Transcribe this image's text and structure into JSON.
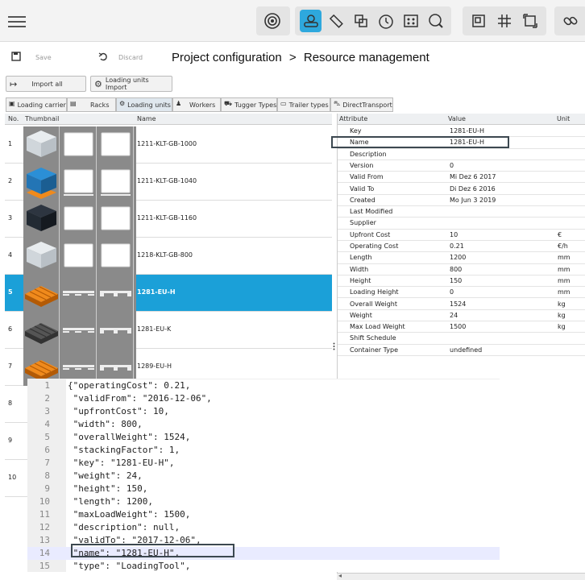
{
  "toolbar": {
    "menu_icon": "hamburger-icon",
    "tools": [
      "lens-icon",
      "resource-icon",
      "ruler-icon",
      "cut-icon",
      "timer-icon",
      "grid-icon",
      "search-zoom-icon",
      "frame-icon",
      "grid-lines-icon",
      "resize-icon",
      "link-icon"
    ],
    "accent": "#2ea8dd"
  },
  "actions": {
    "save": "Save",
    "discard": "Discard"
  },
  "breadcrumb": {
    "project": "Project configuration",
    "sep": ">",
    "page": "Resource management"
  },
  "import": {
    "all": "Import all",
    "loading_units": "Loading units Import"
  },
  "tabs": [
    "Loading carrier",
    "Racks",
    "Loading units",
    "Workers",
    "Tugger Types",
    "Trailer types",
    "DirectTransport"
  ],
  "table": {
    "headers": {
      "no": "No.",
      "thumb": "Thumbnail",
      "name": "Name"
    },
    "rows": [
      {
        "no": "1",
        "name": "1211-KLT-GB-1000",
        "kind": "box-white"
      },
      {
        "no": "2",
        "name": "1211-KLT-GB-1040",
        "kind": "box-blue"
      },
      {
        "no": "3",
        "name": "1211-KLT-GB-1160",
        "kind": "box-dark"
      },
      {
        "no": "4",
        "name": "1218-KLT-GB-800",
        "kind": "box-white"
      },
      {
        "no": "5",
        "name": "1281-EU-H",
        "kind": "pallet-orange"
      },
      {
        "no": "6",
        "name": "1281-EU-K",
        "kind": "pallet-grey"
      },
      {
        "no": "7",
        "name": "1289-EU-H",
        "kind": "pallet-orange"
      },
      {
        "no": "8",
        "name": "",
        "kind": "none"
      },
      {
        "no": "9",
        "name": "",
        "kind": "none"
      },
      {
        "no": "10",
        "name": "",
        "kind": "none"
      }
    ]
  },
  "attributes": {
    "headers": {
      "attribute": "Attribute",
      "value": "Value",
      "unit": "Unit"
    },
    "rows": [
      {
        "a": "Key",
        "v": "1281-EU-H",
        "u": ""
      },
      {
        "a": "Name",
        "v": "1281-EU-H",
        "u": ""
      },
      {
        "a": "Description",
        "v": "",
        "u": ""
      },
      {
        "a": "Version",
        "v": "0",
        "u": ""
      },
      {
        "a": "Valid From",
        "v": "Mi Dez 6 2017",
        "u": ""
      },
      {
        "a": "Valid To",
        "v": "Di Dez 6 2016",
        "u": ""
      },
      {
        "a": "Created",
        "v": "Mo Jun 3 2019",
        "u": ""
      },
      {
        "a": "Last Modified",
        "v": "",
        "u": ""
      },
      {
        "a": "Supplier",
        "v": "",
        "u": ""
      },
      {
        "a": "Upfront Cost",
        "v": "10",
        "u": "€"
      },
      {
        "a": "Operating Cost",
        "v": "0.21",
        "u": "€/h"
      },
      {
        "a": "Length",
        "v": "1200",
        "u": "mm"
      },
      {
        "a": "Width",
        "v": "800",
        "u": "mm"
      },
      {
        "a": "Height",
        "v": "150",
        "u": "mm"
      },
      {
        "a": "Loading Height",
        "v": "0",
        "u": "mm"
      },
      {
        "a": "Overall Weight",
        "v": "1524",
        "u": "kg"
      },
      {
        "a": "Weight",
        "v": "24",
        "u": "kg"
      },
      {
        "a": "Max Load Weight",
        "v": "1500",
        "u": "kg"
      },
      {
        "a": "Shift Schedule",
        "v": "",
        "u": ""
      },
      {
        "a": "Container Type",
        "v": "undefined",
        "u": ""
      }
    ]
  },
  "code": [
    {
      "ln": "1",
      "text": "{\"operatingCost\": 0.21,"
    },
    {
      "ln": "2",
      "text": " \"validFrom\": \"2016-12-06\","
    },
    {
      "ln": "3",
      "text": " \"upfrontCost\": 10,"
    },
    {
      "ln": "4",
      "text": " \"width\": 800,"
    },
    {
      "ln": "5",
      "text": " \"overallWeight\": 1524,"
    },
    {
      "ln": "6",
      "text": " \"stackingFactor\": 1,"
    },
    {
      "ln": "7",
      "text": " \"key\": \"1281-EU-H\","
    },
    {
      "ln": "8",
      "text": " \"weight\": 24,"
    },
    {
      "ln": "9",
      "text": " \"height\": 150,"
    },
    {
      "ln": "10",
      "text": " \"length\": 1200,"
    },
    {
      "ln": "11",
      "text": " \"maxLoadWeight\": 1500,"
    },
    {
      "ln": "12",
      "text": " \"description\": null,"
    },
    {
      "ln": "13",
      "text": " \"validTo\": \"2017-12-06\","
    },
    {
      "ln": "14",
      "text": " \"name\": \"1281-EU-H\","
    },
    {
      "ln": "15",
      "text": " \"type\": \"LoadingTool\","
    }
  ]
}
